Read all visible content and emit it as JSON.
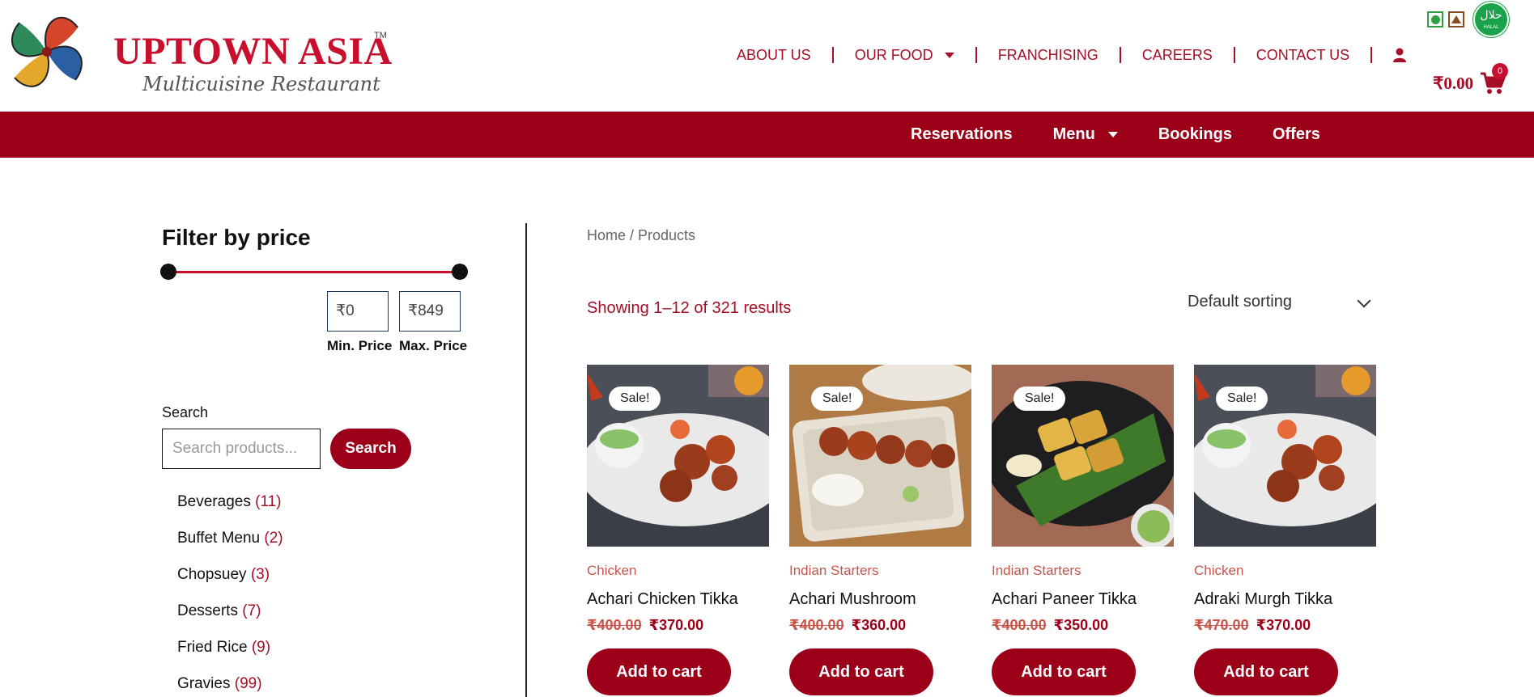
{
  "brand": {
    "name": "UPTOWN ASIA",
    "trademark": "TM",
    "tagline": "Multicuisine Restaurant"
  },
  "top_nav": {
    "items": [
      "ABOUT US",
      "OUR FOOD",
      "FRANCHISING",
      "CAREERS",
      "CONTACT US"
    ],
    "icons": {
      "our_food_dropdown": "caret-down-icon",
      "account": "user-icon"
    }
  },
  "badges": {
    "veg": "veg-icon",
    "nonveg": "nonveg-icon",
    "halal_arabic": "حلال",
    "halal_english": "HALAL"
  },
  "cart": {
    "total": "₹0.00",
    "count": "0",
    "icon": "shopping-cart-icon"
  },
  "band_nav": {
    "items": [
      "Reservations",
      "Menu",
      "Bookings",
      "Offers"
    ]
  },
  "sidebar": {
    "filter_title": "Filter by price",
    "min_price_value": "₹0",
    "max_price_value": "₹849",
    "min_price_label": "Min. Price",
    "max_price_label": "Max. Price",
    "search_label": "Search",
    "search_placeholder": "Search products...",
    "search_button": "Search",
    "categories": [
      {
        "name": "Beverages",
        "count": "(11)"
      },
      {
        "name": "Buffet Menu",
        "count": "(2)"
      },
      {
        "name": "Chopsuey",
        "count": "(3)"
      },
      {
        "name": "Desserts",
        "count": "(7)"
      },
      {
        "name": "Fried Rice",
        "count": "(9)"
      },
      {
        "name": "Gravies",
        "count": "(99)"
      }
    ]
  },
  "main": {
    "breadcrumb": "Home / Products",
    "result_count": "Showing 1–12 of 321 results",
    "sorting": "Default sorting",
    "products": [
      {
        "category": "Chicken",
        "name": "Achari Chicken Tikka",
        "old_price": "₹400.00",
        "new_price": "₹370.00",
        "badge": "Sale!",
        "button": "Add to cart"
      },
      {
        "category": "Indian Starters",
        "name": "Achari Mushroom",
        "old_price": "₹400.00",
        "new_price": "₹360.00",
        "badge": "Sale!",
        "button": "Add to cart"
      },
      {
        "category": "Indian Starters",
        "name": "Achari Paneer Tikka",
        "old_price": "₹400.00",
        "new_price": "₹350.00",
        "badge": "Sale!",
        "button": "Add to cart"
      },
      {
        "category": "Chicken",
        "name": "Adraki Murgh Tikka",
        "old_price": "₹470.00",
        "new_price": "₹370.00",
        "badge": "Sale!",
        "button": "Add to cart"
      }
    ]
  },
  "colors": {
    "brand_red": "#9b0018",
    "accent_red": "#c8102e",
    "halal_green": "#1aa34a"
  }
}
